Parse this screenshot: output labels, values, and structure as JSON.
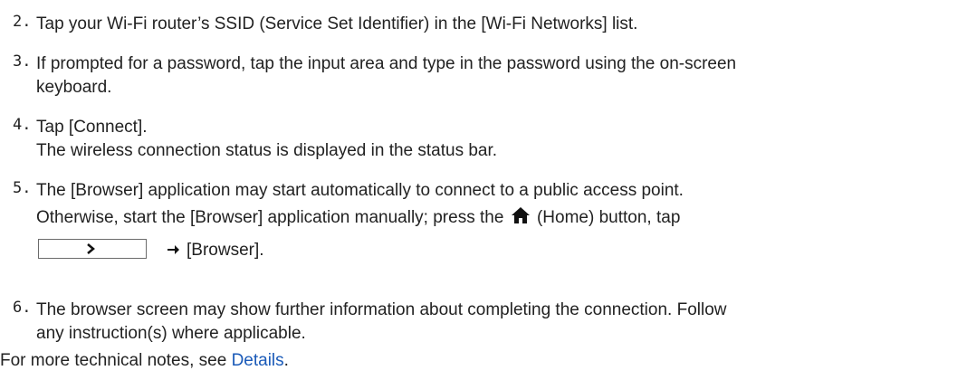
{
  "steps": [
    {
      "num": "2.",
      "lines": [
        "Tap your Wi-Fi router’s SSID (Service Set Identifier) in the [Wi-Fi Networks] list."
      ]
    },
    {
      "num": "3.",
      "lines": [
        "If prompted for a password, tap the input area and type in the password using the on-screen",
        "keyboard."
      ]
    },
    {
      "num": "4.",
      "lines": [
        "Tap [Connect]."
      ],
      "note": "The wireless connection status is displayed in the status bar."
    },
    {
      "num": "5.",
      "lines": [
        "The [Browser] application may start automatically to connect to a public access point."
      ],
      "otherwise_prefix": "Otherwise, start the [Browser] application manually; press the",
      "home_label": "(Home) button, tap",
      "browser_label": "[Browser]."
    },
    {
      "num": "6.",
      "lines": [
        "The browser screen may show further information about completing the connection. Follow",
        "any instruction(s) where applicable."
      ]
    }
  ],
  "footer": {
    "prefix": "For more technical notes, see ",
    "link_text": "Details",
    "suffix": "."
  },
  "icons": {
    "home": "home-icon",
    "chevron": "chevron-right-icon",
    "arrow": "arrow-right-icon"
  }
}
